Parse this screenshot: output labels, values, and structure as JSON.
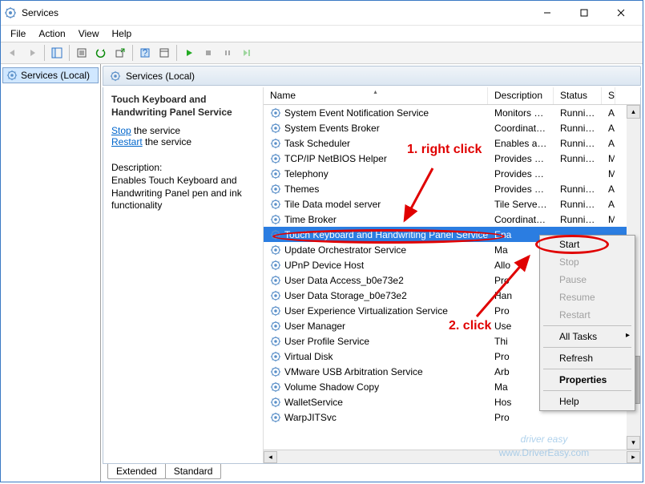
{
  "window": {
    "title": "Services"
  },
  "menu": {
    "file": "File",
    "action": "Action",
    "view": "View",
    "help": "Help"
  },
  "tree": {
    "root": "Services (Local)"
  },
  "header": {
    "label": "Services (Local)"
  },
  "info": {
    "title": "Touch Keyboard and Handwriting Panel Service",
    "stop_link": "Stop",
    "stop_tail": " the service",
    "restart_link": "Restart",
    "restart_tail": " the service",
    "desc_label": "Description:",
    "desc": "Enables Touch Keyboard and Handwriting Panel pen and ink functionality"
  },
  "columns": {
    "name": "Name",
    "desc": "Description",
    "status": "Status",
    "stype": "S"
  },
  "services": [
    {
      "name": "System Event Notification Service",
      "desc": "Monitors sy...",
      "status": "Running",
      "stype": "A"
    },
    {
      "name": "System Events Broker",
      "desc": "Coordinates...",
      "status": "Running",
      "stype": "A"
    },
    {
      "name": "Task Scheduler",
      "desc": "Enables a us...",
      "status": "Running",
      "stype": "A"
    },
    {
      "name": "TCP/IP NetBIOS Helper",
      "desc": "Provides su...",
      "status": "Running",
      "stype": "M"
    },
    {
      "name": "Telephony",
      "desc": "Provides Tel...",
      "status": "",
      "stype": "M"
    },
    {
      "name": "Themes",
      "desc": "Provides us...",
      "status": "Running",
      "stype": "A"
    },
    {
      "name": "Tile Data model server",
      "desc": "Tile Server f...",
      "status": "Running",
      "stype": "A"
    },
    {
      "name": "Time Broker",
      "desc": "Coordinates...",
      "status": "Running",
      "stype": "M"
    },
    {
      "name": "Touch Keyboard and Handwriting Panel Service",
      "desc": "Ena",
      "status": "",
      "stype": ""
    },
    {
      "name": "Update Orchestrator Service",
      "desc": "Ma",
      "status": "",
      "stype": ""
    },
    {
      "name": "UPnP Device Host",
      "desc": "Allo",
      "status": "",
      "stype": ""
    },
    {
      "name": "User Data Access_b0e73e2",
      "desc": "Pro",
      "status": "",
      "stype": ""
    },
    {
      "name": "User Data Storage_b0e73e2",
      "desc": "Han",
      "status": "",
      "stype": ""
    },
    {
      "name": "User Experience Virtualization Service",
      "desc": "Pro",
      "status": "",
      "stype": ""
    },
    {
      "name": "User Manager",
      "desc": "Use",
      "status": "",
      "stype": ""
    },
    {
      "name": "User Profile Service",
      "desc": "Thi",
      "status": "",
      "stype": ""
    },
    {
      "name": "Virtual Disk",
      "desc": "Pro",
      "status": "",
      "stype": ""
    },
    {
      "name": "VMware USB Arbitration Service",
      "desc": "Arb",
      "status": "",
      "stype": ""
    },
    {
      "name": "Volume Shadow Copy",
      "desc": "Ma",
      "status": "",
      "stype": ""
    },
    {
      "name": "WalletService",
      "desc": "Hos",
      "status": "",
      "stype": ""
    },
    {
      "name": "WarpJITSvc",
      "desc": "Pro",
      "status": "",
      "stype": ""
    }
  ],
  "selected_index": 8,
  "tabs": {
    "extended": "Extended",
    "standard": "Standard"
  },
  "context_menu": {
    "start": "Start",
    "stop": "Stop",
    "pause": "Pause",
    "resume": "Resume",
    "restart": "Restart",
    "all_tasks": "All Tasks",
    "refresh": "Refresh",
    "properties": "Properties",
    "help": "Help"
  },
  "annotations": {
    "step1": "1. right  click",
    "step2": "2. click"
  },
  "watermark": {
    "line1": "driver easy",
    "line2": "www.DriverEasy.com"
  }
}
